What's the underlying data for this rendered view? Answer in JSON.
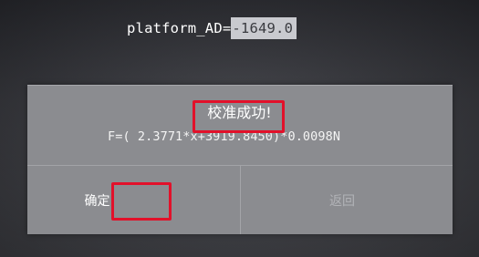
{
  "readout": {
    "label": "platform_AD=",
    "value": "-1649.0"
  },
  "dialog": {
    "status": "校准成功!",
    "formula": "F=(  2.3771*x+3919.8450)*0.0098N",
    "buttons": {
      "confirm": "确定",
      "back": "返回"
    }
  },
  "colors": {
    "highlight": "#e2112a",
    "dialog_bg": "#8b8c90",
    "screen_bg": "#3b3c42"
  }
}
